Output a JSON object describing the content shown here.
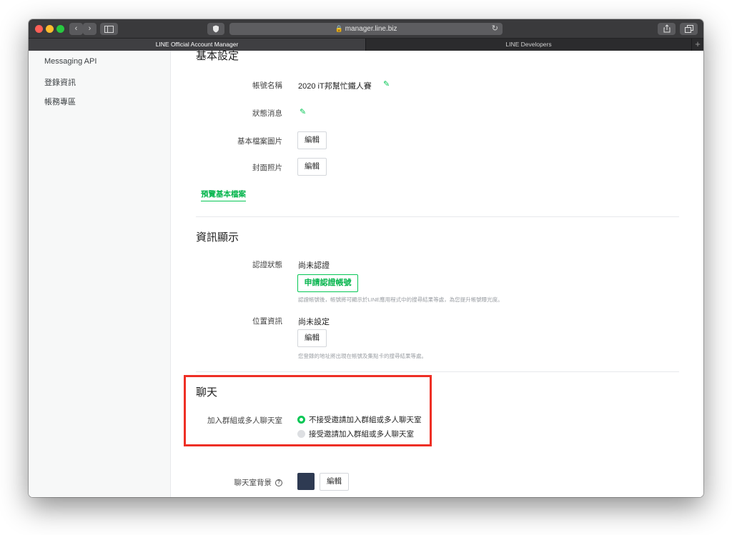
{
  "browser": {
    "url": "manager.line.biz",
    "tabs": [
      {
        "label": "LINE Official Account Manager",
        "active": true
      },
      {
        "label": "LINE Developers",
        "active": false
      }
    ],
    "icons": {
      "back": "‹",
      "forward": "›",
      "plus": "+"
    }
  },
  "sidebar": {
    "items": [
      {
        "label": "Messaging API"
      },
      {
        "label": "登錄資訊"
      },
      {
        "label": "帳務專區"
      }
    ]
  },
  "basic_settings": {
    "title": "基本設定",
    "account_name_label": "帳號名稱",
    "account_name_value": "2020 iT邦幫忙鐵人賽",
    "status_message_label": "狀態消息",
    "profile_image_label": "基本檔案圖片",
    "profile_image_button": "編輯",
    "cover_photo_label": "封面照片",
    "cover_photo_button": "編輯",
    "preview_link": "預覽基本檔案"
  },
  "info_display": {
    "title": "資訊顯示",
    "verification_label": "認證狀態",
    "verification_value": "尚未認證",
    "verification_button": "申請認證帳號",
    "verification_hint": "認證帳號後，帳號將可顯示於LINE應用程式中的搜尋結果等處，為您提升帳號曝光度。",
    "location_label": "位置資訊",
    "location_value": "尚未設定",
    "location_button": "編輯",
    "location_hint": "您登錄的地址將出現在帳號及集點卡的搜尋結果等處。"
  },
  "chat": {
    "title": "聊天",
    "group_label": "加入群組或多人聊天室",
    "options": [
      {
        "label": "不接受邀請加入群組或多人聊天室",
        "selected": true
      },
      {
        "label": "接受邀請加入群組或多人聊天室",
        "selected": false
      }
    ],
    "background_label": "聊天室背景",
    "background_color": "#2e3a52",
    "background_button": "編輯"
  },
  "colors": {
    "accent": "#06c755",
    "highlight_box": "#ee2f25"
  }
}
